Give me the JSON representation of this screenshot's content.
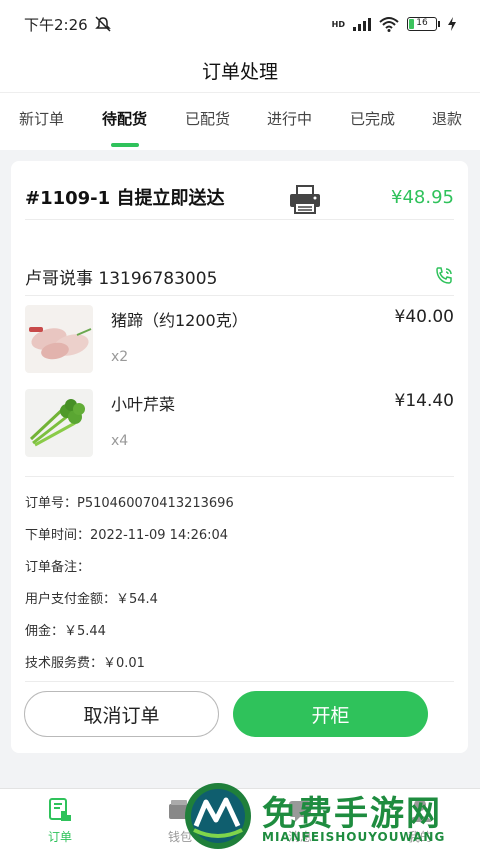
{
  "status_bar": {
    "time": "下午2:26",
    "network": "HD",
    "battery": "16"
  },
  "header": {
    "title": "订单处理"
  },
  "tabs": [
    {
      "label": "新订单"
    },
    {
      "label": "待配货",
      "active": true
    },
    {
      "label": "已配货"
    },
    {
      "label": "进行中"
    },
    {
      "label": "已完成"
    },
    {
      "label": "退款"
    }
  ],
  "order": {
    "title": "#1109-1 自提立即送达",
    "total": "¥48.95",
    "customer": "卢哥说事 13196783005",
    "items": [
      {
        "name": "猪蹄（约1200克）",
        "qty": "x2",
        "price": "¥40.00"
      },
      {
        "name": "小叶芹菜",
        "qty": "x4",
        "price": "¥14.40"
      }
    ],
    "info": [
      {
        "text": "订单号：P510460070413213696"
      },
      {
        "text": "下单时间：2022-11-09 14:26:04"
      },
      {
        "text": "订单备注："
      },
      {
        "text": "用户支付金额：￥54.4"
      },
      {
        "text": "佣金：￥5.44"
      },
      {
        "text": "技术服务费：￥0.01"
      }
    ],
    "cancel_label": "取消订单",
    "open_label": "开柜"
  },
  "bottom_nav": [
    {
      "label": "订单",
      "active": true
    },
    {
      "label": "钱包"
    },
    {
      "label": "消息"
    },
    {
      "label": "我的"
    }
  ],
  "watermark": {
    "text": "免费手游网",
    "sub": "MIANFEISHOUYOUWANG"
  },
  "colors": {
    "accent": "#2fc25b",
    "background": "#f2f3f5"
  }
}
